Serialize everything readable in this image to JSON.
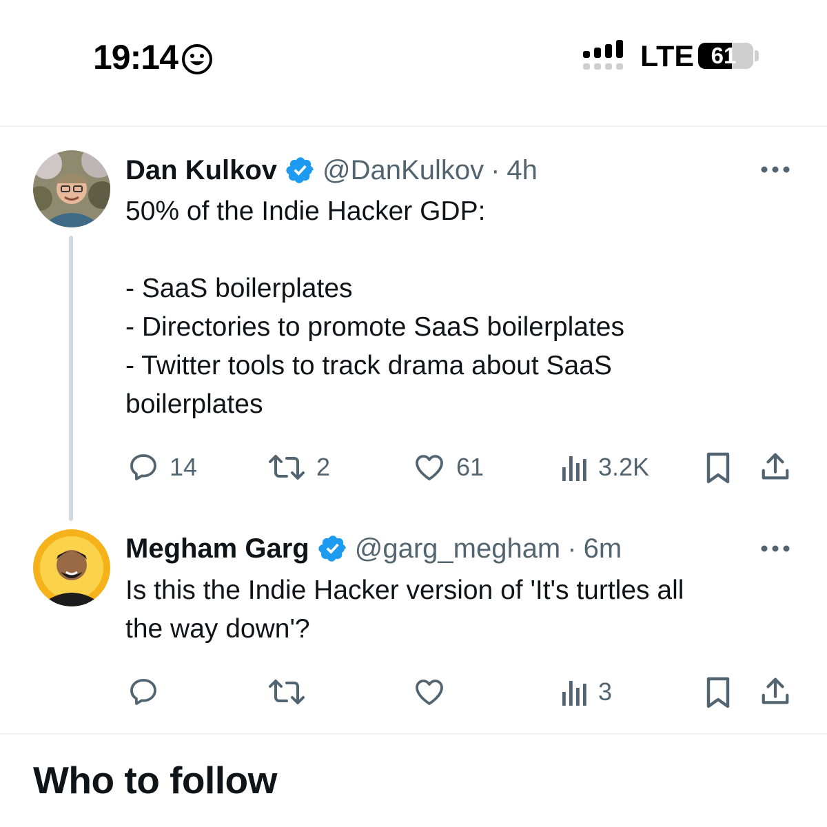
{
  "status_bar": {
    "time": "19:14",
    "network": "LTE",
    "battery_percent": "61"
  },
  "tweets": [
    {
      "author_name": "Dan Kulkov",
      "handle": "@DanKulkov",
      "separator": "·",
      "timestamp": "4h",
      "verified": true,
      "text_lines": [
        "50% of the Indie Hacker GDP:",
        "",
        "- SaaS boilerplates",
        "- Directories to promote SaaS boilerplates",
        "- Twitter tools to track drama about SaaS",
        "boilerplates"
      ],
      "replies": "14",
      "reposts": "2",
      "likes": "61",
      "views": "3.2K"
    },
    {
      "author_name": "Megham Garg",
      "handle": "@garg_megham",
      "separator": "·",
      "timestamp": "6m",
      "verified": true,
      "text_lines": [
        "Is this the Indie Hacker version of 'It's turtles all",
        "the way down'?"
      ],
      "replies": "",
      "reposts": "",
      "likes": "",
      "views": "3"
    }
  ],
  "section": {
    "title": "Who to follow"
  },
  "colors": {
    "verified_blue": "#1d9bf0",
    "secondary_text": "#536471",
    "primary_text": "#0f1419",
    "thread_line": "#cfd9de"
  }
}
